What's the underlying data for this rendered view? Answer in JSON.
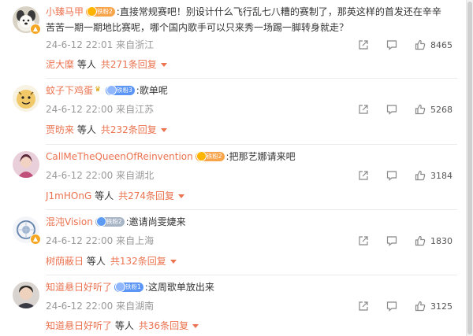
{
  "action_icons": [
    "share-icon",
    "comment-icon",
    "like-icon"
  ],
  "colors": {
    "username": "#eb7350",
    "meta": "#999999",
    "text": "#333333"
  },
  "comments": [
    {
      "username": "小臻马甲",
      "fan_badge": "铁粉2",
      "text_line1": ":直接常规赛吧！别设计什么飞行乱七八糟的赛制了，那英这样的首发还在辛辛",
      "text_line2": "苦苦一期一期地比赛呢，哪个国内歌手可以只来秀一场踢一脚转身就走？",
      "time": "24-6-12 22:01",
      "location": "来自浙江",
      "likes": "8465",
      "reply_user": "泥大糜",
      "reply_suffix": "等人",
      "reply_total": "共271条回复"
    },
    {
      "username": "蚊子下鸡蛋",
      "fan_badge": "铁粉3",
      "text_line1": ":歌单呢",
      "time": "24-6-12 22:00",
      "location": "来自江苏",
      "likes": "5268",
      "reply_user": "贾昉来",
      "reply_suffix": "等人",
      "reply_total": "共232条回复"
    },
    {
      "username": "CallMeTheQueenOfReinvention",
      "fan_badge": "铁粉2",
      "text_line1": ":把那艺娜请来吧",
      "time": "24-6-12 22:00",
      "location": "来自湖北",
      "likes": "3184",
      "reply_user": "J1mHOnG",
      "reply_suffix": "等人",
      "reply_total": "共274条回复"
    },
    {
      "username": "混沌Vision",
      "fan_badge": "铁粉2",
      "text_line1": ":邀请尚雯婕来",
      "time": "24-6-12 22:00",
      "location": "来自上海",
      "likes": "1830",
      "reply_user": "树荫蔽日",
      "reply_suffix": "等人",
      "reply_total": "共132条回复"
    },
    {
      "username": "知道悬日好听了",
      "fan_badge": "铁粉1",
      "text_line1": ":这周歌单放出来",
      "time": "24-6-12 22:00",
      "location": "来自湖南",
      "likes": "3125",
      "reply_user": "知道悬日好听了",
      "reply_suffix": "等人",
      "reply_total": "共36条回复"
    }
  ]
}
